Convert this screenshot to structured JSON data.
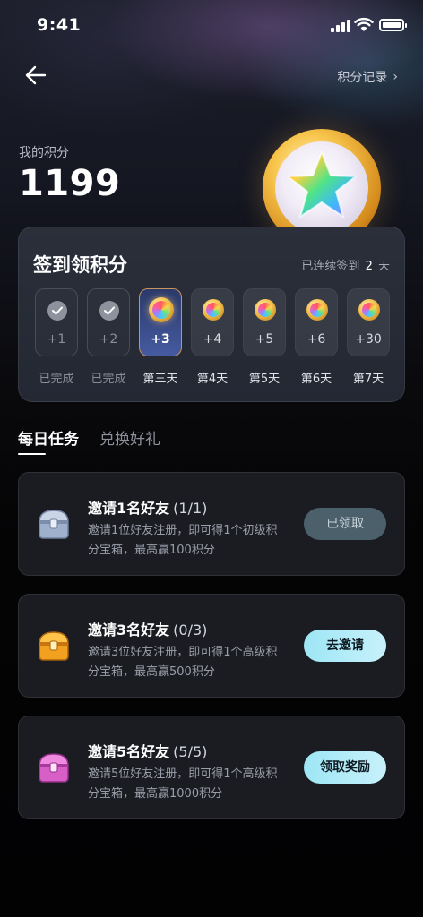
{
  "status_bar": {
    "time": "9:41"
  },
  "header": {
    "history_label": "积分记录",
    "history_chevron": "›"
  },
  "points": {
    "label": "我的积分",
    "value": "1199"
  },
  "checkin": {
    "title": "签到领积分",
    "streak_prefix": "已连续签到",
    "streak_days": "2",
    "streak_suffix": "天",
    "days": [
      {
        "amount": "+1",
        "label": "已完成",
        "state": "done"
      },
      {
        "amount": "+2",
        "label": "已完成",
        "state": "done"
      },
      {
        "amount": "+3",
        "label": "第三天",
        "state": "today"
      },
      {
        "amount": "+4",
        "label": "第4天",
        "state": "upcoming"
      },
      {
        "amount": "+5",
        "label": "第5天",
        "state": "upcoming"
      },
      {
        "amount": "+6",
        "label": "第6天",
        "state": "upcoming"
      },
      {
        "amount": "+30",
        "label": "第7天",
        "state": "upcoming"
      }
    ]
  },
  "tabs": [
    {
      "label": "每日任务",
      "active": true
    },
    {
      "label": "兑换好礼",
      "active": false
    }
  ],
  "tasks": [
    {
      "title": "邀请1名好友",
      "progress": "(1/1)",
      "description": "邀请1位好友注册，即可得1个初级积分宝箱，最高赢100积分",
      "button": "已领取",
      "chest": "silver-chest-icon",
      "color": "#b9c3d6"
    },
    {
      "title": "邀请3名好友",
      "progress": "(0/3)",
      "description": "邀请3位好友注册，即可得1个高级积分宝箱，最高赢500积分",
      "button": "去邀请",
      "chest": "gold-chest-icon",
      "color": "#f4a62a"
    },
    {
      "title": "邀请5名好友",
      "progress": "(5/5)",
      "description": "邀请5位好友注册，即可得1个高级积分宝箱，最高赢1000积分",
      "button": "领取奖励",
      "chest": "pink-chest-icon",
      "color": "#e66bd0"
    }
  ]
}
